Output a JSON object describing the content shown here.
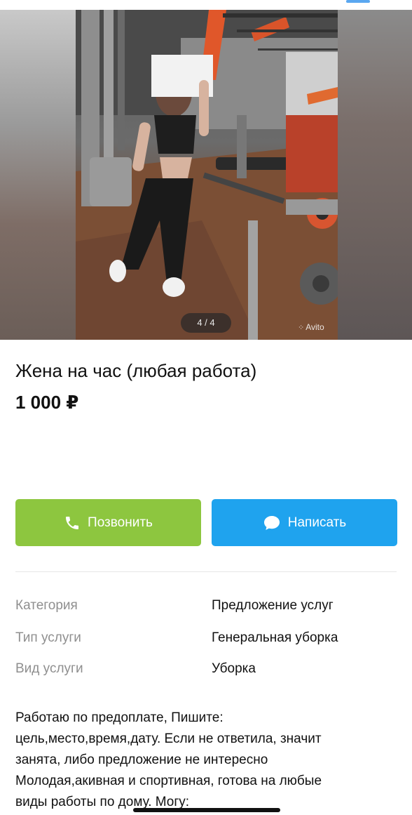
{
  "gallery": {
    "counter": "4 / 4",
    "watermark": "Avito"
  },
  "listing": {
    "title": "Жена на час (любая работа)",
    "price": "1 000 ₽"
  },
  "actions": {
    "call_label": "Позвонить",
    "write_label": "Написать",
    "call_color": "#8dc63f",
    "write_color": "#1fa3ee"
  },
  "params": [
    {
      "label": "Категория",
      "value": "Предложение услуг"
    },
    {
      "label": "Тип услуги",
      "value": "Генеральная уборка"
    },
    {
      "label": "Вид услуги",
      "value": "Уборка"
    }
  ],
  "description": {
    "lines": [
      "Работаю по предоплате, Пишите:",
      "цель,место,время,дату. Если не ответила, значит",
      "занята, либо предложение не интересно",
      "Молодая,акивная и спортивная, готова на любые",
      "виды работы по дому. Могу:"
    ]
  }
}
